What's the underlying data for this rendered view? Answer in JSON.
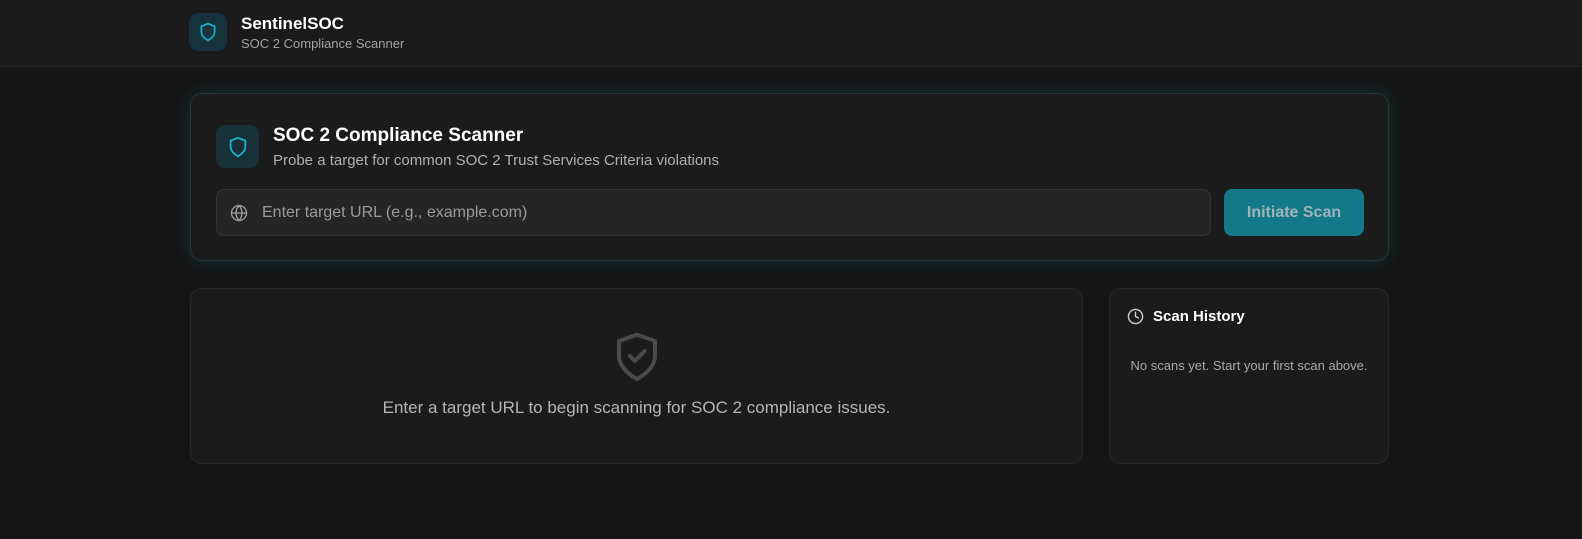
{
  "header": {
    "brand_name": "SentinelSOC",
    "brand_subtitle": "SOC 2 Compliance Scanner",
    "logo_icon": "shield-icon"
  },
  "scanner": {
    "title": "SOC 2 Compliance Scanner",
    "description": "Probe a target for common SOC 2 Trust Services Criteria violations",
    "url_input": {
      "value": "",
      "placeholder": "Enter target URL (e.g., example.com)",
      "icon": "globe-icon"
    },
    "scan_button_label": "Initiate Scan",
    "scan_button_enabled": false
  },
  "results": {
    "empty_icon": "shield-check-icon",
    "empty_message": "Enter a target URL to begin scanning for SOC 2 compliance issues."
  },
  "history": {
    "icon": "clock-icon",
    "title": "Scan History",
    "empty_message": "No scans yet. Start your first scan above."
  },
  "colors": {
    "accent": "#1ab0cc",
    "button_bg": "#137989",
    "background": "#151515",
    "card": "#1b1b1b"
  }
}
